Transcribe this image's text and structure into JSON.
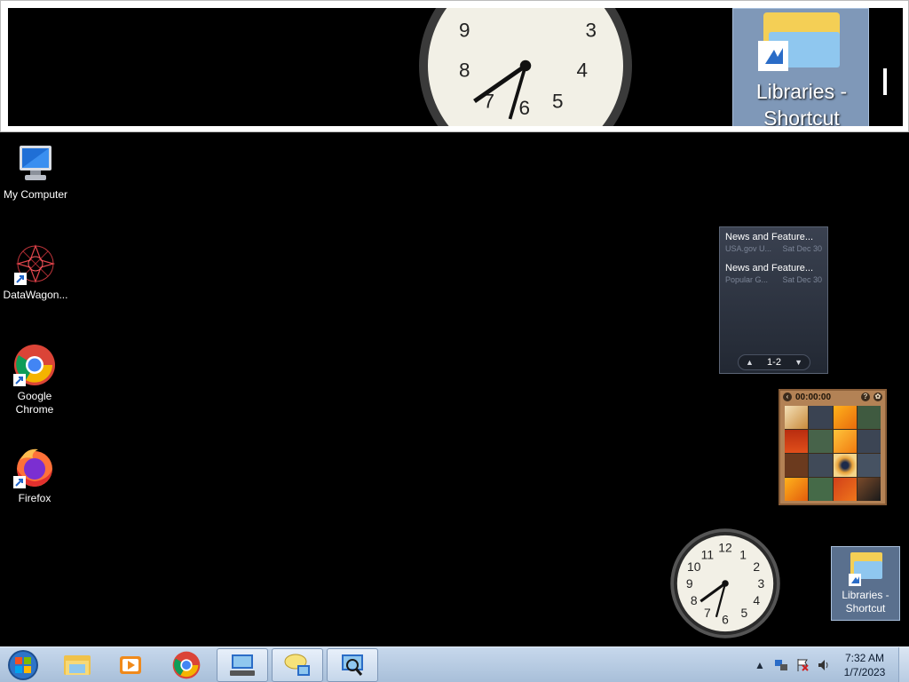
{
  "desktop": {
    "icons": [
      {
        "label": "My Computer",
        "icon": "computer-icon"
      },
      {
        "label": "DataWagon...",
        "icon": "datawagon-icon"
      },
      {
        "label": "Google Chrome",
        "icon": "chrome-icon"
      },
      {
        "label": "Firefox",
        "icon": "firefox-icon"
      },
      {
        "label": "Libraries - Shortcut",
        "icon": "libraries-icon"
      }
    ]
  },
  "magnifier": {
    "libraries_text": "Libraries - Shortcut"
  },
  "news_gadget": {
    "items": [
      {
        "title": "News and Feature...",
        "source": "USA.gov U...",
        "date": "Sat Dec 30"
      },
      {
        "title": "News and Feature...",
        "source": "Popular G...",
        "date": "Sat Dec 30"
      }
    ],
    "page_indicator": "1-2"
  },
  "puzzle_gadget": {
    "timer": "00:00:00"
  },
  "taskbar": {
    "time": "7:32 AM",
    "date": "1/7/2023",
    "pinned": [
      "windows-explorer-icon",
      "media-player-icon",
      "chrome-icon",
      "keyboard-screen-icon",
      "speech-bubble-icon",
      "magnifier-icon"
    ]
  },
  "colors": {
    "desktop_bg": "#000000",
    "taskbar_bg": "#b6cbe3",
    "selection": "#7f98b8"
  }
}
